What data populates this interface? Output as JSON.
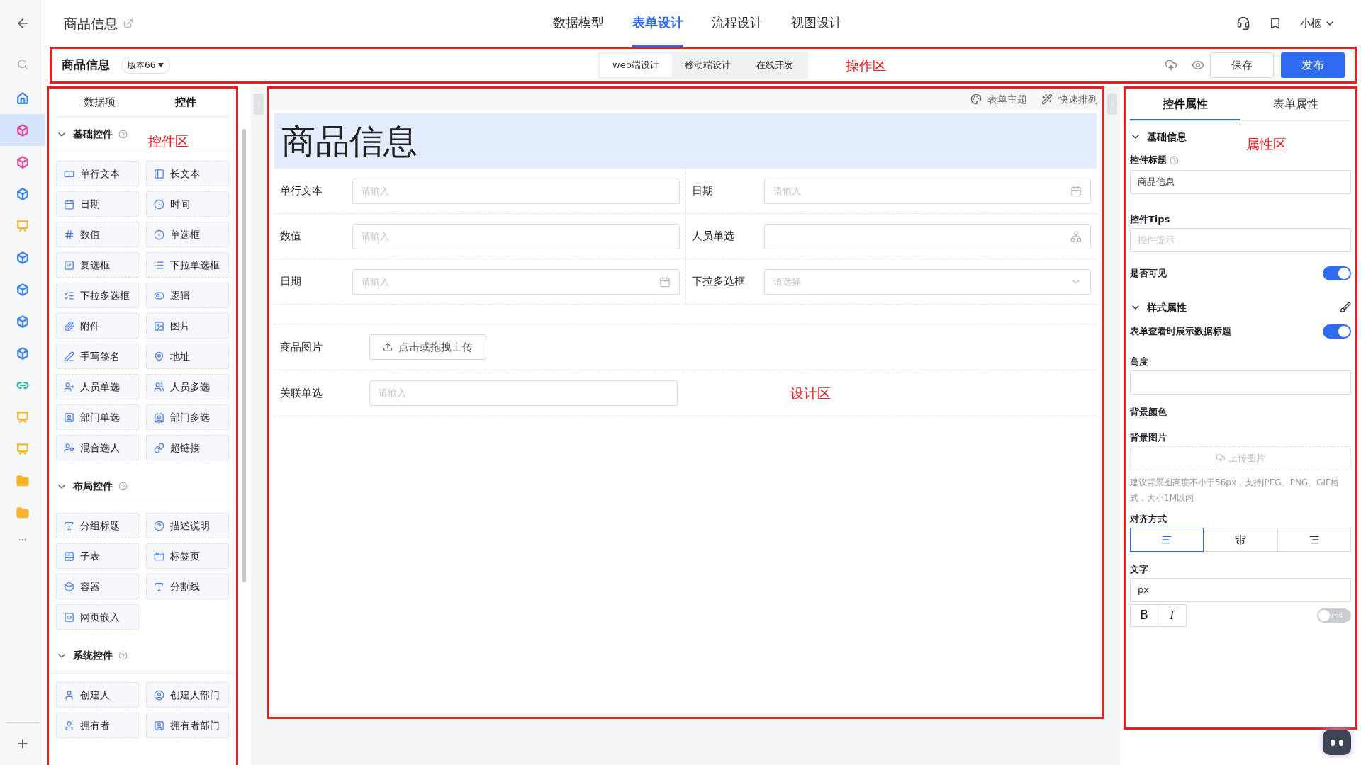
{
  "nav_rail": {
    "items": [
      {
        "kind": "home",
        "color": "#3b82f6",
        "selected": false
      },
      {
        "kind": "cube",
        "color": "#ec4899",
        "selected": true
      },
      {
        "kind": "cube",
        "color": "#ec4899",
        "selected": false
      },
      {
        "kind": "cube",
        "color": "#3b82f6",
        "selected": false
      },
      {
        "kind": "board",
        "color": "#f5b52e",
        "selected": false
      },
      {
        "kind": "cube",
        "color": "#3b82f6",
        "selected": false
      },
      {
        "kind": "cube",
        "color": "#3b82f6",
        "selected": false
      },
      {
        "kind": "cube",
        "color": "#3b82f6",
        "selected": false
      },
      {
        "kind": "cube",
        "color": "#3b82f6",
        "selected": false
      },
      {
        "kind": "link",
        "color": "#2bb5a5",
        "selected": false
      },
      {
        "kind": "board",
        "color": "#f5b52e",
        "selected": false
      },
      {
        "kind": "board",
        "color": "#f5b52e",
        "selected": false
      },
      {
        "kind": "folder",
        "color": "#f5b52e",
        "selected": false
      },
      {
        "kind": "folder",
        "color": "#f5b52e",
        "selected": false
      }
    ],
    "more": "···"
  },
  "header": {
    "title": "商品信息",
    "tabs": [
      {
        "label": "数据模型",
        "selected": false
      },
      {
        "label": "表单设计",
        "selected": true
      },
      {
        "label": "流程设计",
        "selected": false
      },
      {
        "label": "视图设计",
        "selected": false
      }
    ],
    "user": "小柩"
  },
  "toolbar": {
    "title": "商品信息",
    "version": "版本66",
    "modes": [
      {
        "label": "web端设计",
        "selected": true
      },
      {
        "label": "移动端设计",
        "selected": false
      },
      {
        "label": "在线开发",
        "selected": false
      }
    ],
    "annotation": "操作区",
    "save": "保存",
    "publish": "发布"
  },
  "controls_panel": {
    "tabs": [
      {
        "label": "数据项",
        "selected": false
      },
      {
        "label": "控件",
        "selected": true
      }
    ],
    "annotation": "控件区",
    "sections": [
      {
        "title": "基础控件",
        "expanded": true,
        "items": [
          "单行文本",
          "长文本",
          "日期",
          "时间",
          "数值",
          "单选框",
          "复选框",
          "下拉单选框",
          "下拉多选框",
          "逻辑",
          "附件",
          "图片",
          "手写签名",
          "地址",
          "人员单选",
          "人员多选",
          "部门单选",
          "部门多选",
          "混合选人",
          "超链接"
        ]
      },
      {
        "title": "布局控件",
        "expanded": true,
        "items": [
          "分组标题",
          "描述说明",
          "子表",
          "标签页",
          "容器",
          "分割线",
          "网页嵌入"
        ]
      },
      {
        "title": "系统控件",
        "expanded": true,
        "items": [
          "创建人",
          "创建人部门",
          "拥有者",
          "拥有者部门"
        ]
      }
    ]
  },
  "design": {
    "tools": [
      "表单主题",
      "快速排列"
    ],
    "form_title": "商品信息",
    "grid_rows": [
      [
        {
          "label": "单行文本",
          "kind": "text",
          "placeholder": "请输入"
        },
        {
          "label": "日期",
          "kind": "date",
          "placeholder": "请输入"
        }
      ],
      [
        {
          "label": "数值",
          "kind": "text",
          "placeholder": "请输入"
        },
        {
          "label": "人员单选",
          "kind": "person"
        }
      ],
      [
        {
          "label": "日期",
          "kind": "date",
          "placeholder": "请输入"
        },
        {
          "label": "下拉多选框",
          "kind": "select",
          "placeholder": "请选择"
        }
      ]
    ],
    "rows": [
      {
        "kind": "upload",
        "label": "商品图片",
        "button": "点击或拖拽上传"
      },
      {
        "kind": "text",
        "label": "关联单选",
        "placeholder": "请输入"
      }
    ],
    "annotation": "设计区"
  },
  "properties": {
    "tabs": [
      {
        "label": "控件属性",
        "selected": true
      },
      {
        "label": "表单属性",
        "selected": false
      }
    ],
    "annotation": "属性区",
    "basic": {
      "title": "基础信息",
      "expanded": true,
      "control_title_label": "控件标题",
      "control_title_value": "商品信息",
      "tips_label": "控件Tips",
      "tips_placeholder": "控件提示",
      "visible_label": "是否可见",
      "visible_on": true
    },
    "style": {
      "title": "样式属性",
      "expanded": true,
      "show_title_label": "表单查看时展示数据标题",
      "show_title_on": true,
      "height_label": "高度",
      "bg_color_label": "背景颜色",
      "bg_image_label": "背景图片",
      "upload": "上传图片",
      "hint": "建议背景图高度不小于56px，支持JPEG、PNG、GIF格式，大小1M以内",
      "align_label": "对齐方式",
      "align": [
        {
          "selected": true
        },
        {
          "selected": false
        },
        {
          "selected": false
        }
      ],
      "font_label": "文字",
      "font_value": "px",
      "bold": "B",
      "italic": "I",
      "css": "css",
      "css_on": false
    }
  }
}
